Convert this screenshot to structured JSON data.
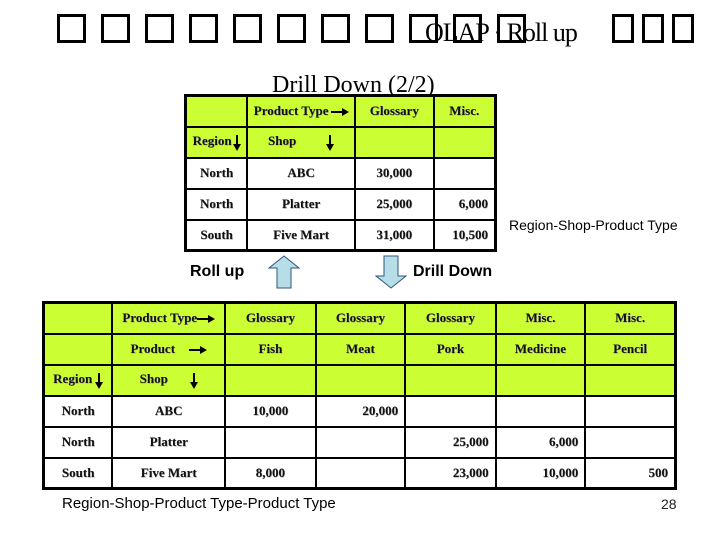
{
  "slide": {
    "title_tofu_count": 13,
    "title_text": "OLAP · Roll up",
    "subtitle": "Drill Down (2/2)",
    "page_number": "28"
  },
  "table1": {
    "header_row1": [
      "",
      "Product Type",
      "Glossary",
      "Misc."
    ],
    "header_row2": [
      "Region",
      "Shop",
      "",
      ""
    ],
    "rows": [
      [
        "North",
        "ABC",
        "30,000",
        ""
      ],
      [
        "North",
        "Platter",
        "25,000",
        "6,000"
      ],
      [
        "South",
        "Five Mart",
        "31,000",
        "10,500"
      ]
    ],
    "caption": "Region-Shop-Product Type"
  },
  "operations": {
    "roll_up_label": "Roll up",
    "drill_down_label": "Drill Down",
    "arrow_color": "#b7dee8"
  },
  "table2": {
    "header_row1": [
      "",
      "Product Type",
      "Glossary",
      "Glossary",
      "Glossary",
      "Misc.",
      "Misc."
    ],
    "header_row2": [
      "",
      "Product",
      "Fish",
      "Meat",
      "Pork",
      "Medicine",
      "Pencil"
    ],
    "header_row3": [
      "Region",
      "Shop",
      "",
      "",
      "",
      "",
      ""
    ],
    "rows": [
      [
        "North",
        "ABC",
        "10,000",
        "20,000",
        "",
        "",
        ""
      ],
      [
        "North",
        "Platter",
        "",
        "",
        "25,000",
        "6,000",
        ""
      ],
      [
        "South",
        "Five Mart",
        "8,000",
        "",
        "23,000",
        "10,000",
        "500"
      ]
    ],
    "caption": "Region-Shop-Product Type-Product Type"
  },
  "colors": {
    "header_fill": "#ccff33",
    "border": "#000000"
  }
}
